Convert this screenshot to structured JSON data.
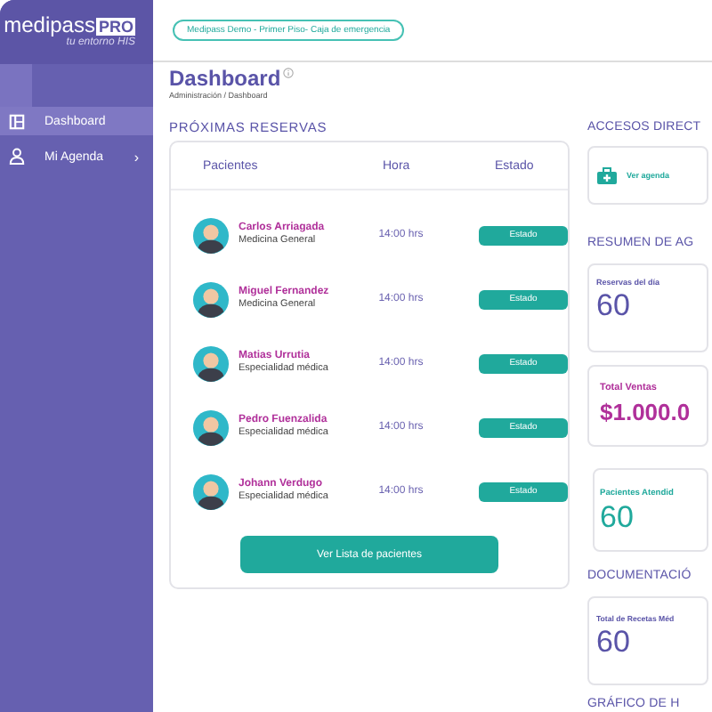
{
  "brand": {
    "name": "medipass",
    "badge": "PRO",
    "tagline": "tu entorno HIS"
  },
  "location_badge": "Medipass Demo - Primer Piso- Caja de emergencia",
  "sidebar": {
    "items": [
      {
        "label": "Dashboard",
        "selected": true
      },
      {
        "label": "Mi Agenda",
        "selected": false,
        "chevron": "›"
      }
    ]
  },
  "page": {
    "title": "Dashboard",
    "breadcrumb": "Administración / Dashboard"
  },
  "reservas": {
    "title": "PRÓXIMAS RESERVAS",
    "columns": [
      "Pacientes",
      "Hora",
      "Estado"
    ],
    "rows": [
      {
        "name": "Carlos Arriagada",
        "specialty": "Medicina General",
        "time": "14:00 hrs",
        "status": "Estado"
      },
      {
        "name": "Miguel Fernandez",
        "specialty": "Medicina General",
        "time": "14:00 hrs",
        "status": "Estado"
      },
      {
        "name": "Matias Urrutia",
        "specialty": "Especialidad médica",
        "time": "14:00 hrs",
        "status": "Estado"
      },
      {
        "name": "Pedro Fuenzalida",
        "specialty": "Especialidad médica",
        "time": "14:00 hrs",
        "status": "Estado"
      },
      {
        "name": "Johann Verdugo",
        "specialty": "Especialidad médica",
        "time": "14:00 hrs",
        "status": "Estado"
      }
    ],
    "button": "Ver Lista de pacientes"
  },
  "accesos": {
    "title": "ACCESOS DIRECT",
    "items": [
      {
        "label": "Ver agenda"
      }
    ]
  },
  "resumen": {
    "title": "RESUMEN DE AG",
    "cards": [
      {
        "label": "Reservas del día",
        "value": "60",
        "color": "#5a54a8"
      },
      {
        "label": "Total Ventas",
        "value": "$1.000.0",
        "color": "#b0309a"
      },
      {
        "label": "Pacientes Atendid",
        "value": "60",
        "color": "#20a99c"
      }
    ]
  },
  "documentacion": {
    "title": "DOCUMENTACIÓ",
    "cards": [
      {
        "label": "Total de Recetas Méd",
        "value": "60",
        "color": "#5a54a8"
      }
    ]
  },
  "grafico": {
    "title": "GRÁFICO DE H"
  }
}
